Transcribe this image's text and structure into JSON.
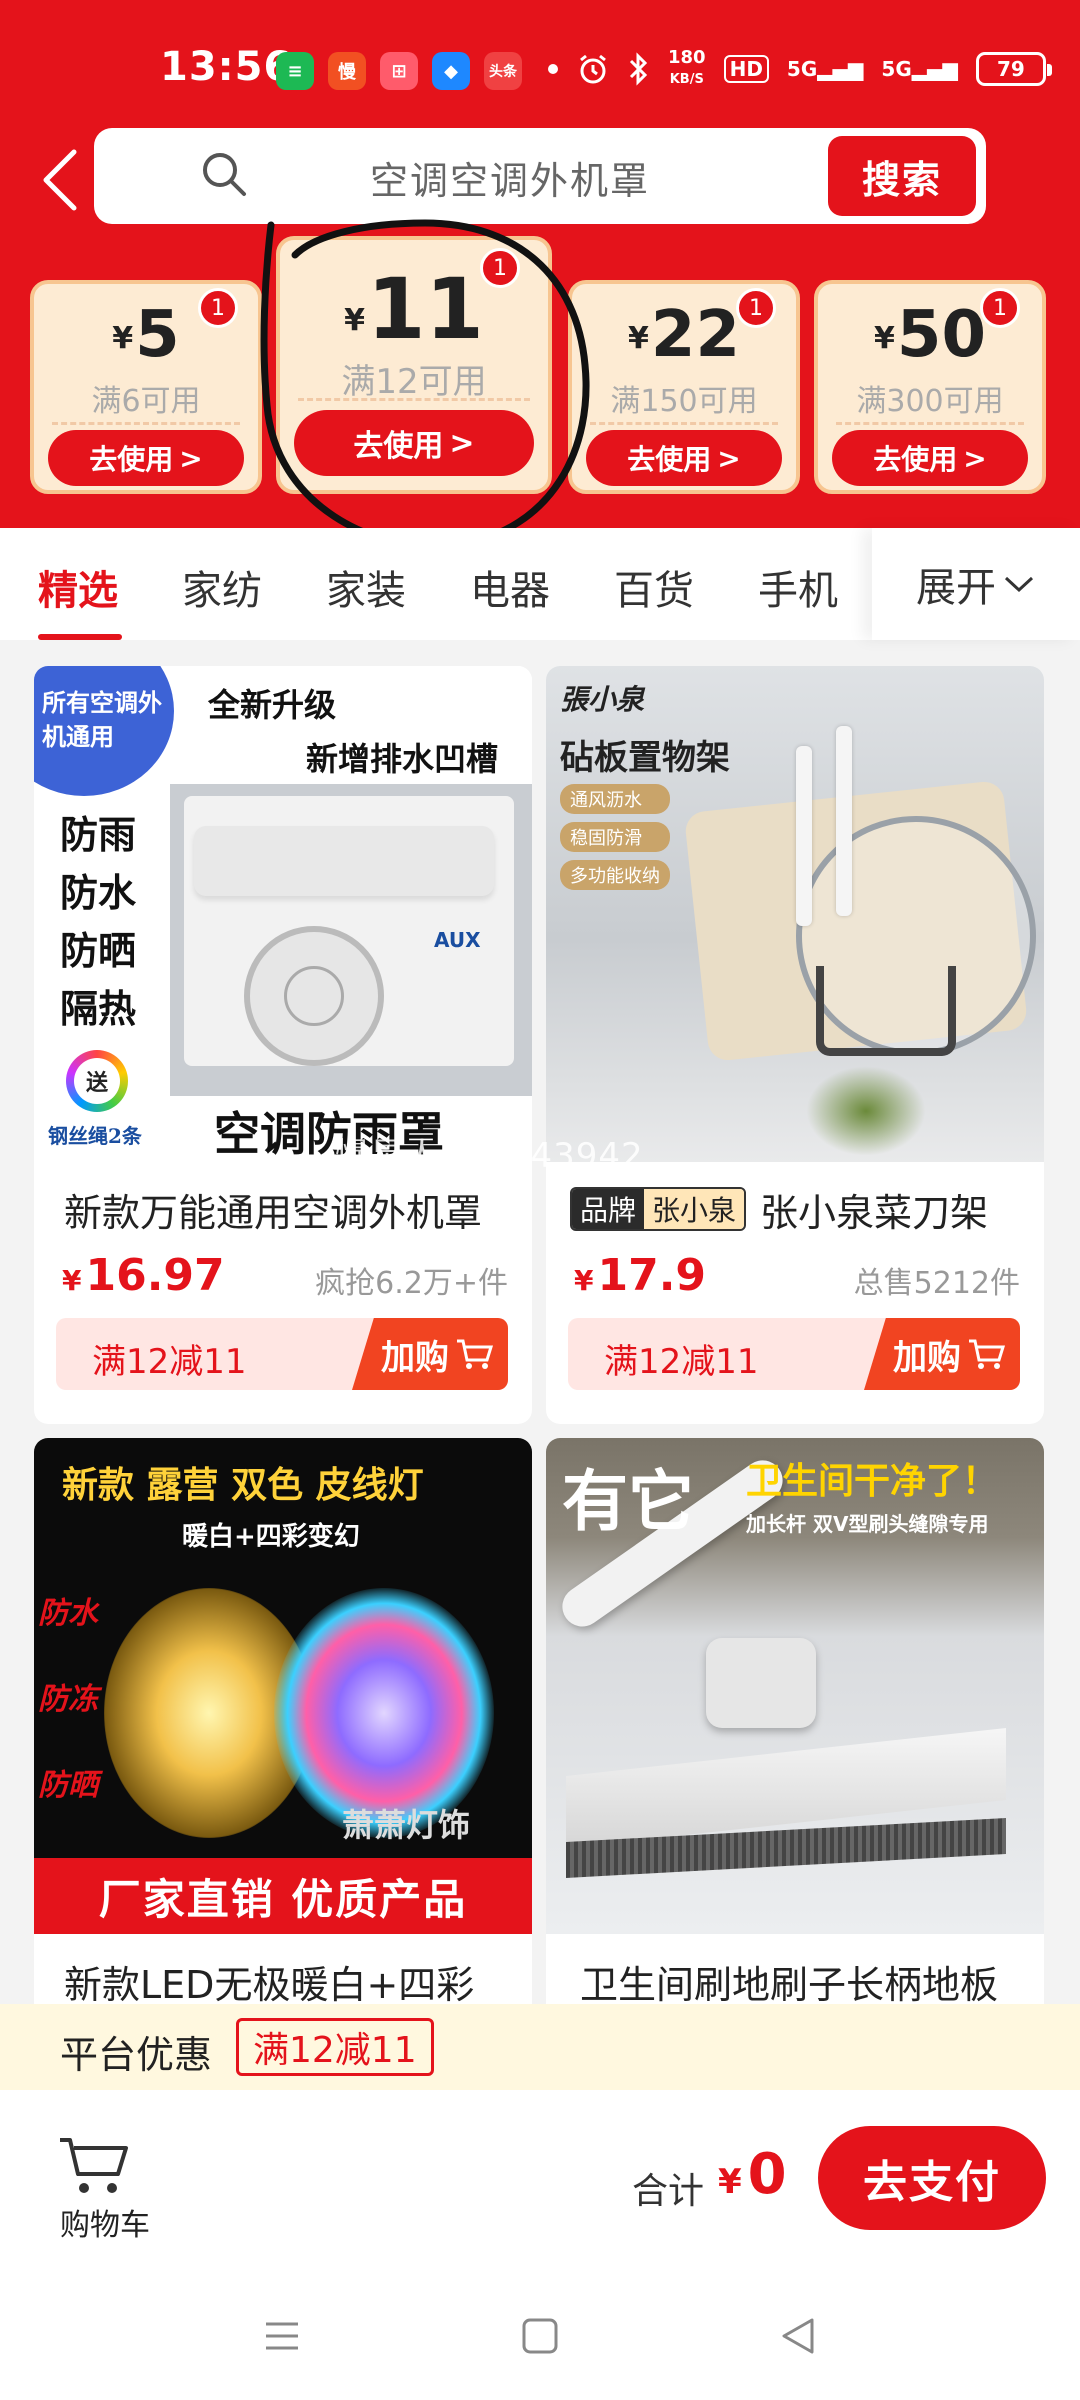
{
  "status_bar": {
    "time": "13:56",
    "apps": [
      {
        "name": "spotify-icon",
        "color": "#1db954",
        "glyph": "≡"
      },
      {
        "name": "man-app-icon",
        "color": "#f25022",
        "glyph": "慢"
      },
      {
        "name": "app-grid-icon",
        "color": "#ff5b6b",
        "glyph": "⊞"
      },
      {
        "name": "blue-app-icon",
        "color": "#1e88ff",
        "glyph": "◆"
      },
      {
        "name": "toutiao-icon",
        "color": "#f04142",
        "glyph": "头条"
      }
    ],
    "net_speed": "180",
    "net_unit": "KB/S",
    "hd": "HD",
    "signal1": "5G",
    "signal2": "5G",
    "battery": "79"
  },
  "search": {
    "query": "空调空调外机罩",
    "button": "搜索"
  },
  "coupons": [
    {
      "amount": "5",
      "condition": "满6可用",
      "action": "去使用",
      "badge": "1"
    },
    {
      "amount": "11",
      "condition": "满12可用",
      "action": "去使用",
      "badge": "1"
    },
    {
      "amount": "22",
      "condition": "满150可用",
      "action": "去使用",
      "badge": "1"
    },
    {
      "amount": "50",
      "condition": "满300可用",
      "action": "去使用",
      "badge": "1"
    }
  ],
  "currency": "¥",
  "tabs": {
    "items": [
      "精选",
      "家纺",
      "家装",
      "电器",
      "百货",
      "手机"
    ],
    "expand": "展开"
  },
  "products": [
    {
      "title": "新款万能通用空调外机罩",
      "price": "16.97",
      "sold": "疯抢6.2万+件",
      "promo": "满12减11",
      "add": "加购",
      "img_texts": {
        "badge": "所有空调外机通用",
        "top1": "全新升级",
        "top2": "新增排水凹槽",
        "side": [
          "防雨",
          "防水",
          "防晒",
          "隔热"
        ],
        "gift": "送",
        "gift_note": "钢丝绳2条",
        "bottom": "空调防雨罩",
        "unit_brand": "AUX"
      }
    },
    {
      "title": "张小泉菜刀架",
      "brand_label": "品牌",
      "brand_name": "张小泉",
      "price": "17.9",
      "sold": "总售5212件",
      "promo": "满12减11",
      "add": "加购",
      "img_texts": {
        "logo": "張小泉",
        "heading": "砧板置物架",
        "features": [
          "通风沥水",
          "稳固防滑",
          "多功能收纳"
        ]
      }
    },
    {
      "title": "新款LED无极暖白+四彩",
      "img_texts": {
        "heading": "新款 露营 双色 皮线灯",
        "sub": "暖白+四彩变幻",
        "side": [
          "防水",
          "防冻",
          "防晒"
        ],
        "shop": "萧萧灯饰",
        "bottom": "厂家直销 优质产品"
      }
    },
    {
      "title": "卫生间刷地刷子长柄地板",
      "img_texts": {
        "heading1": "有它",
        "heading2": "卫生间干净了！",
        "sub": "加长杆 双V型刷头缝隙专用"
      }
    }
  ],
  "watermark": "慢星人240343942",
  "promo_bar": {
    "label": "平台优惠",
    "tag": "满12减11"
  },
  "bottom": {
    "cart_label": "购物车",
    "total_label": "合计",
    "total_value": "0",
    "pay": "去支付"
  },
  "colors": {
    "brand_red": "#e4131b",
    "coupon_bg": "#fdebd3",
    "promo_bg": "#fff8df"
  }
}
